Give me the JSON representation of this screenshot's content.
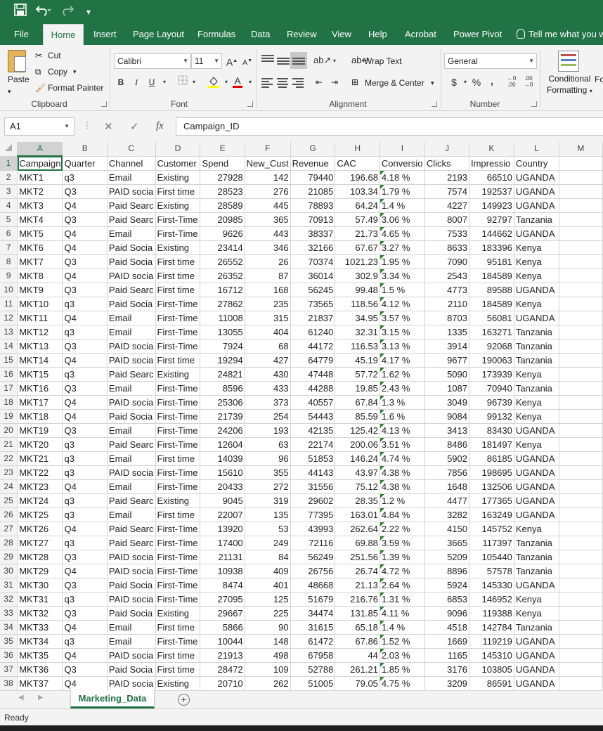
{
  "ribbon_tabs": [
    "File",
    "Home",
    "Insert",
    "Page Layout",
    "Formulas",
    "Data",
    "Review",
    "View",
    "Help",
    "Acrobat",
    "Power Pivot",
    "Tell me what you wa"
  ],
  "clipboard": {
    "paste": "Paste",
    "cut": "Cut",
    "copy": "Copy",
    "format_painter": "Format Painter",
    "label": "Clipboard"
  },
  "font": {
    "name": "Calibri",
    "size": "11",
    "grow": "A",
    "shrink": "A",
    "bold": "B",
    "italic": "I",
    "underline": "U",
    "label": "Font"
  },
  "alignment": {
    "wrap_text": "Wrap Text",
    "merge_center": "Merge & Center",
    "label": "Alignment"
  },
  "number": {
    "format": "General",
    "currency": "$",
    "percent": "%",
    "comma": ",",
    "label": "Number"
  },
  "styles": {
    "conditional_formatting_line1": "Conditional",
    "conditional_formatting_line2": "Formatting",
    "format_as_table_fragment": "Fo"
  },
  "formula_bar": {
    "name_box": "A1",
    "fx": "fx",
    "value": "Campaign_ID"
  },
  "columns": [
    "A",
    "B",
    "C",
    "D",
    "E",
    "F",
    "G",
    "H",
    "I",
    "J",
    "K",
    "L",
    "M"
  ],
  "rows": [
    [
      "1",
      "Campaign",
      "Quarter",
      "Channel",
      "Customer",
      "Spend",
      "New_Cust",
      "Revenue",
      "CAC",
      "Conversio",
      "Clicks",
      "Impressio",
      "Country",
      ""
    ],
    [
      "2",
      "MKT1",
      "q3",
      "Email",
      "Existing",
      "27928",
      "142",
      "79440",
      "196.68",
      "4.18 %",
      "2193",
      "66510",
      "UGANDA",
      ""
    ],
    [
      "3",
      "MKT2",
      "Q3",
      "PAID socia",
      "First time",
      "28523",
      "276",
      "21085",
      "103.34",
      "1.79 %",
      "7574",
      "192537",
      "UGANDA",
      ""
    ],
    [
      "4",
      "MKT3",
      "Q4",
      "Paid Searc",
      "Existing",
      "28589",
      "445",
      "78893",
      "64.24",
      "1.4 %",
      "4227",
      "149923",
      "UGANDA",
      ""
    ],
    [
      "5",
      "MKT4",
      "Q3",
      "Paid Searc",
      "First-Time",
      "20985",
      "365",
      "70913",
      "57.49",
      "3.06 %",
      "8007",
      "92797",
      "Tanzania",
      ""
    ],
    [
      "6",
      "MKT5",
      "Q4",
      "Email",
      "First-Time",
      "9626",
      "443",
      "38337",
      "21.73",
      "4.65 %",
      "7533",
      "144662",
      "UGANDA",
      ""
    ],
    [
      "7",
      "MKT6",
      "Q4",
      "Paid Socia",
      "Existing",
      "23414",
      "346",
      "32166",
      "67.67",
      "3.27 %",
      "8633",
      "183396",
      "Kenya",
      ""
    ],
    [
      "8",
      "MKT7",
      "Q3",
      "Paid Socia",
      "First time",
      "26552",
      "26",
      "70374",
      "1021.23",
      "1.95 %",
      "7090",
      "95181",
      "Kenya",
      ""
    ],
    [
      "9",
      "MKT8",
      "Q4",
      "PAID socia",
      "First time",
      "26352",
      "87",
      "36014",
      "302.9",
      "3.34 %",
      "2543",
      "184589",
      "Kenya",
      ""
    ],
    [
      "10",
      "MKT9",
      "Q3",
      "Paid Searc",
      "First time",
      "16712",
      "168",
      "56245",
      "99.48",
      "1.5 %",
      "4773",
      "89588",
      "UGANDA",
      ""
    ],
    [
      "11",
      "MKT10",
      "q3",
      "Paid Socia",
      "First-Time",
      "27862",
      "235",
      "73565",
      "118.56",
      "4.12 %",
      "2110",
      "184589",
      "Kenya",
      ""
    ],
    [
      "12",
      "MKT11",
      "Q4",
      "Email",
      "First-Time",
      "11008",
      "315",
      "21837",
      "34.95",
      "3.57 %",
      "8703",
      "56081",
      "UGANDA",
      ""
    ],
    [
      "13",
      "MKT12",
      "q3",
      "Email",
      "First-Time",
      "13055",
      "404",
      "61240",
      "32.31",
      "3.15 %",
      "1335",
      "163271",
      "Tanzania",
      ""
    ],
    [
      "14",
      "MKT13",
      "Q3",
      "PAID socia",
      "First-Time",
      "7924",
      "68",
      "44172",
      "116.53",
      "3.13 %",
      "3914",
      "92068",
      "Tanzania",
      ""
    ],
    [
      "15",
      "MKT14",
      "Q4",
      "PAID socia",
      "First time",
      "19294",
      "427",
      "64779",
      "45.19",
      "4.17 %",
      "9677",
      "190063",
      "Tanzania",
      ""
    ],
    [
      "16",
      "MKT15",
      "q3",
      "Paid Searc",
      "Existing",
      "24821",
      "430",
      "47448",
      "57.72",
      "1.62 %",
      "5090",
      "173939",
      "Kenya",
      ""
    ],
    [
      "17",
      "MKT16",
      "Q3",
      "Email",
      "First-Time",
      "8596",
      "433",
      "44288",
      "19.85",
      "2.43 %",
      "1087",
      "70940",
      "Tanzania",
      ""
    ],
    [
      "18",
      "MKT17",
      "Q4",
      "PAID socia",
      "First-Time",
      "25306",
      "373",
      "40557",
      "67.84",
      "1.3 %",
      "3049",
      "96739",
      "Kenya",
      ""
    ],
    [
      "19",
      "MKT18",
      "Q4",
      "Paid Socia",
      "First-Time",
      "21739",
      "254",
      "54443",
      "85.59",
      "1.6 %",
      "9084",
      "99132",
      "Kenya",
      ""
    ],
    [
      "20",
      "MKT19",
      "Q3",
      "Email",
      "First-Time",
      "24206",
      "193",
      "42135",
      "125.42",
      "4.13 %",
      "3413",
      "83430",
      "UGANDA",
      ""
    ],
    [
      "21",
      "MKT20",
      "q3",
      "Paid Searc",
      "First-Time",
      "12604",
      "63",
      "22174",
      "200.06",
      "3.51 %",
      "8486",
      "181497",
      "Kenya",
      ""
    ],
    [
      "22",
      "MKT21",
      "q3",
      "Email",
      "First time",
      "14039",
      "96",
      "51853",
      "146.24",
      "4.74 %",
      "5902",
      "86185",
      "UGANDA",
      ""
    ],
    [
      "23",
      "MKT22",
      "q3",
      "PAID socia",
      "First-Time",
      "15610",
      "355",
      "44143",
      "43.97",
      "4.38 %",
      "7856",
      "198695",
      "UGANDA",
      ""
    ],
    [
      "24",
      "MKT23",
      "Q4",
      "Email",
      "First-Time",
      "20433",
      "272",
      "31556",
      "75.12",
      "4.38 %",
      "1648",
      "132506",
      "UGANDA",
      ""
    ],
    [
      "25",
      "MKT24",
      "q3",
      "Paid Searc",
      "Existing",
      "9045",
      "319",
      "29602",
      "28.35",
      "1.2 %",
      "4477",
      "177365",
      "UGANDA",
      ""
    ],
    [
      "26",
      "MKT25",
      "q3",
      "Email",
      "First time",
      "22007",
      "135",
      "77395",
      "163.01",
      "4.84 %",
      "3282",
      "163249",
      "UGANDA",
      ""
    ],
    [
      "27",
      "MKT26",
      "Q4",
      "Paid Searc",
      "First-Time",
      "13920",
      "53",
      "43993",
      "262.64",
      "2.22 %",
      "4150",
      "145752",
      "Kenya",
      ""
    ],
    [
      "28",
      "MKT27",
      "q3",
      "Paid Searc",
      "First-Time",
      "17400",
      "249",
      "72116",
      "69.88",
      "3.59 %",
      "3665",
      "117397",
      "Tanzania",
      ""
    ],
    [
      "29",
      "MKT28",
      "Q3",
      "PAID socia",
      "First-Time",
      "21131",
      "84",
      "56249",
      "251.56",
      "1.39 %",
      "5209",
      "105440",
      "Tanzania",
      ""
    ],
    [
      "30",
      "MKT29",
      "Q4",
      "PAID socia",
      "First-Time",
      "10938",
      "409",
      "26756",
      "26.74",
      "4.72 %",
      "8896",
      "57578",
      "Tanzania",
      ""
    ],
    [
      "31",
      "MKT30",
      "Q3",
      "Paid Socia",
      "First-Time",
      "8474",
      "401",
      "48668",
      "21.13",
      "2.64 %",
      "5924",
      "145330",
      "UGANDA",
      ""
    ],
    [
      "32",
      "MKT31",
      "q3",
      "PAID socia",
      "First-Time",
      "27095",
      "125",
      "51679",
      "216.76",
      "1.31 %",
      "6853",
      "146952",
      "Kenya",
      ""
    ],
    [
      "33",
      "MKT32",
      "Q3",
      "Paid Socia",
      "Existing",
      "29667",
      "225",
      "34474",
      "131.85",
      "4.11 %",
      "9096",
      "119388",
      "Kenya",
      ""
    ],
    [
      "34",
      "MKT33",
      "Q4",
      "Email",
      "First time",
      "5866",
      "90",
      "31615",
      "65.18",
      "1.4 %",
      "4518",
      "142784",
      "Tanzania",
      ""
    ],
    [
      "35",
      "MKT34",
      "q3",
      "Email",
      "First-Time",
      "10044",
      "148",
      "61472",
      "67.86",
      "1.52 %",
      "1669",
      "119219",
      "UGANDA",
      ""
    ],
    [
      "36",
      "MKT35",
      "Q4",
      "PAID socia",
      "First time",
      "21913",
      "498",
      "67958",
      "44",
      "2.03 %",
      "1165",
      "145310",
      "UGANDA",
      ""
    ],
    [
      "37",
      "MKT36",
      "Q3",
      "Paid Socia",
      "First time",
      "28472",
      "109",
      "52788",
      "261.21",
      "1.85 %",
      "3176",
      "103805",
      "UGANDA",
      ""
    ],
    [
      "38",
      "MKT37",
      "Q4",
      "PAID socia",
      "Existing",
      "20710",
      "262",
      "51005",
      "79.05",
      "4.75 %",
      "3209",
      "86591",
      "UGANDA",
      ""
    ]
  ],
  "sheet_tabs": [
    "Marketing_Data"
  ],
  "status": "Ready",
  "colors": {
    "accent": "#217346",
    "ribbon": "#f3f3f3",
    "gridline": "#d4d4d4",
    "error_flag": "#2e7d32"
  }
}
